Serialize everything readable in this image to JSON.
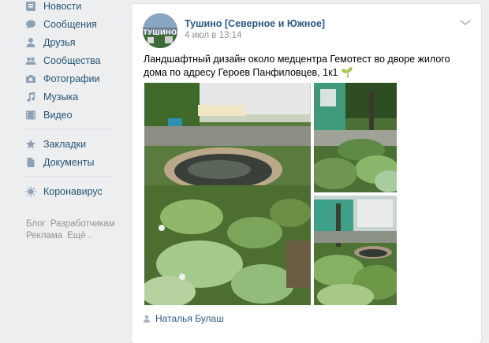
{
  "sidebar": {
    "items": [
      {
        "label": "Новости",
        "icon": "news-icon"
      },
      {
        "label": "Сообщения",
        "icon": "messages-icon"
      },
      {
        "label": "Друзья",
        "icon": "friends-icon"
      },
      {
        "label": "Сообщества",
        "icon": "communities-icon"
      },
      {
        "label": "Фотографии",
        "icon": "photos-icon"
      },
      {
        "label": "Музыка",
        "icon": "music-icon"
      },
      {
        "label": "Видео",
        "icon": "video-icon"
      },
      {
        "label": "Закладки",
        "icon": "bookmarks-icon"
      },
      {
        "label": "Документы",
        "icon": "documents-icon"
      },
      {
        "label": "Коронавирус",
        "icon": "coronavirus-icon"
      }
    ],
    "footer": [
      "Блог",
      "Разработчикам",
      "Реклама",
      "Ещё"
    ]
  },
  "post": {
    "author": "Тушино [Северное и Южное]",
    "avatar_text": "ТУШИНО",
    "date": "4 июл в 13:14",
    "text": "Ландшафтный дизайн около медцентра Гемотест во дворе жилого дома по адресу Героев Панфиловцев, 1к1",
    "text_emoji": "🌱",
    "signer": "Наталья Булаш"
  },
  "colors": {
    "link": "#2a5885",
    "nav_text": "#285473",
    "meta": "#939393",
    "background": "#edeef0"
  }
}
